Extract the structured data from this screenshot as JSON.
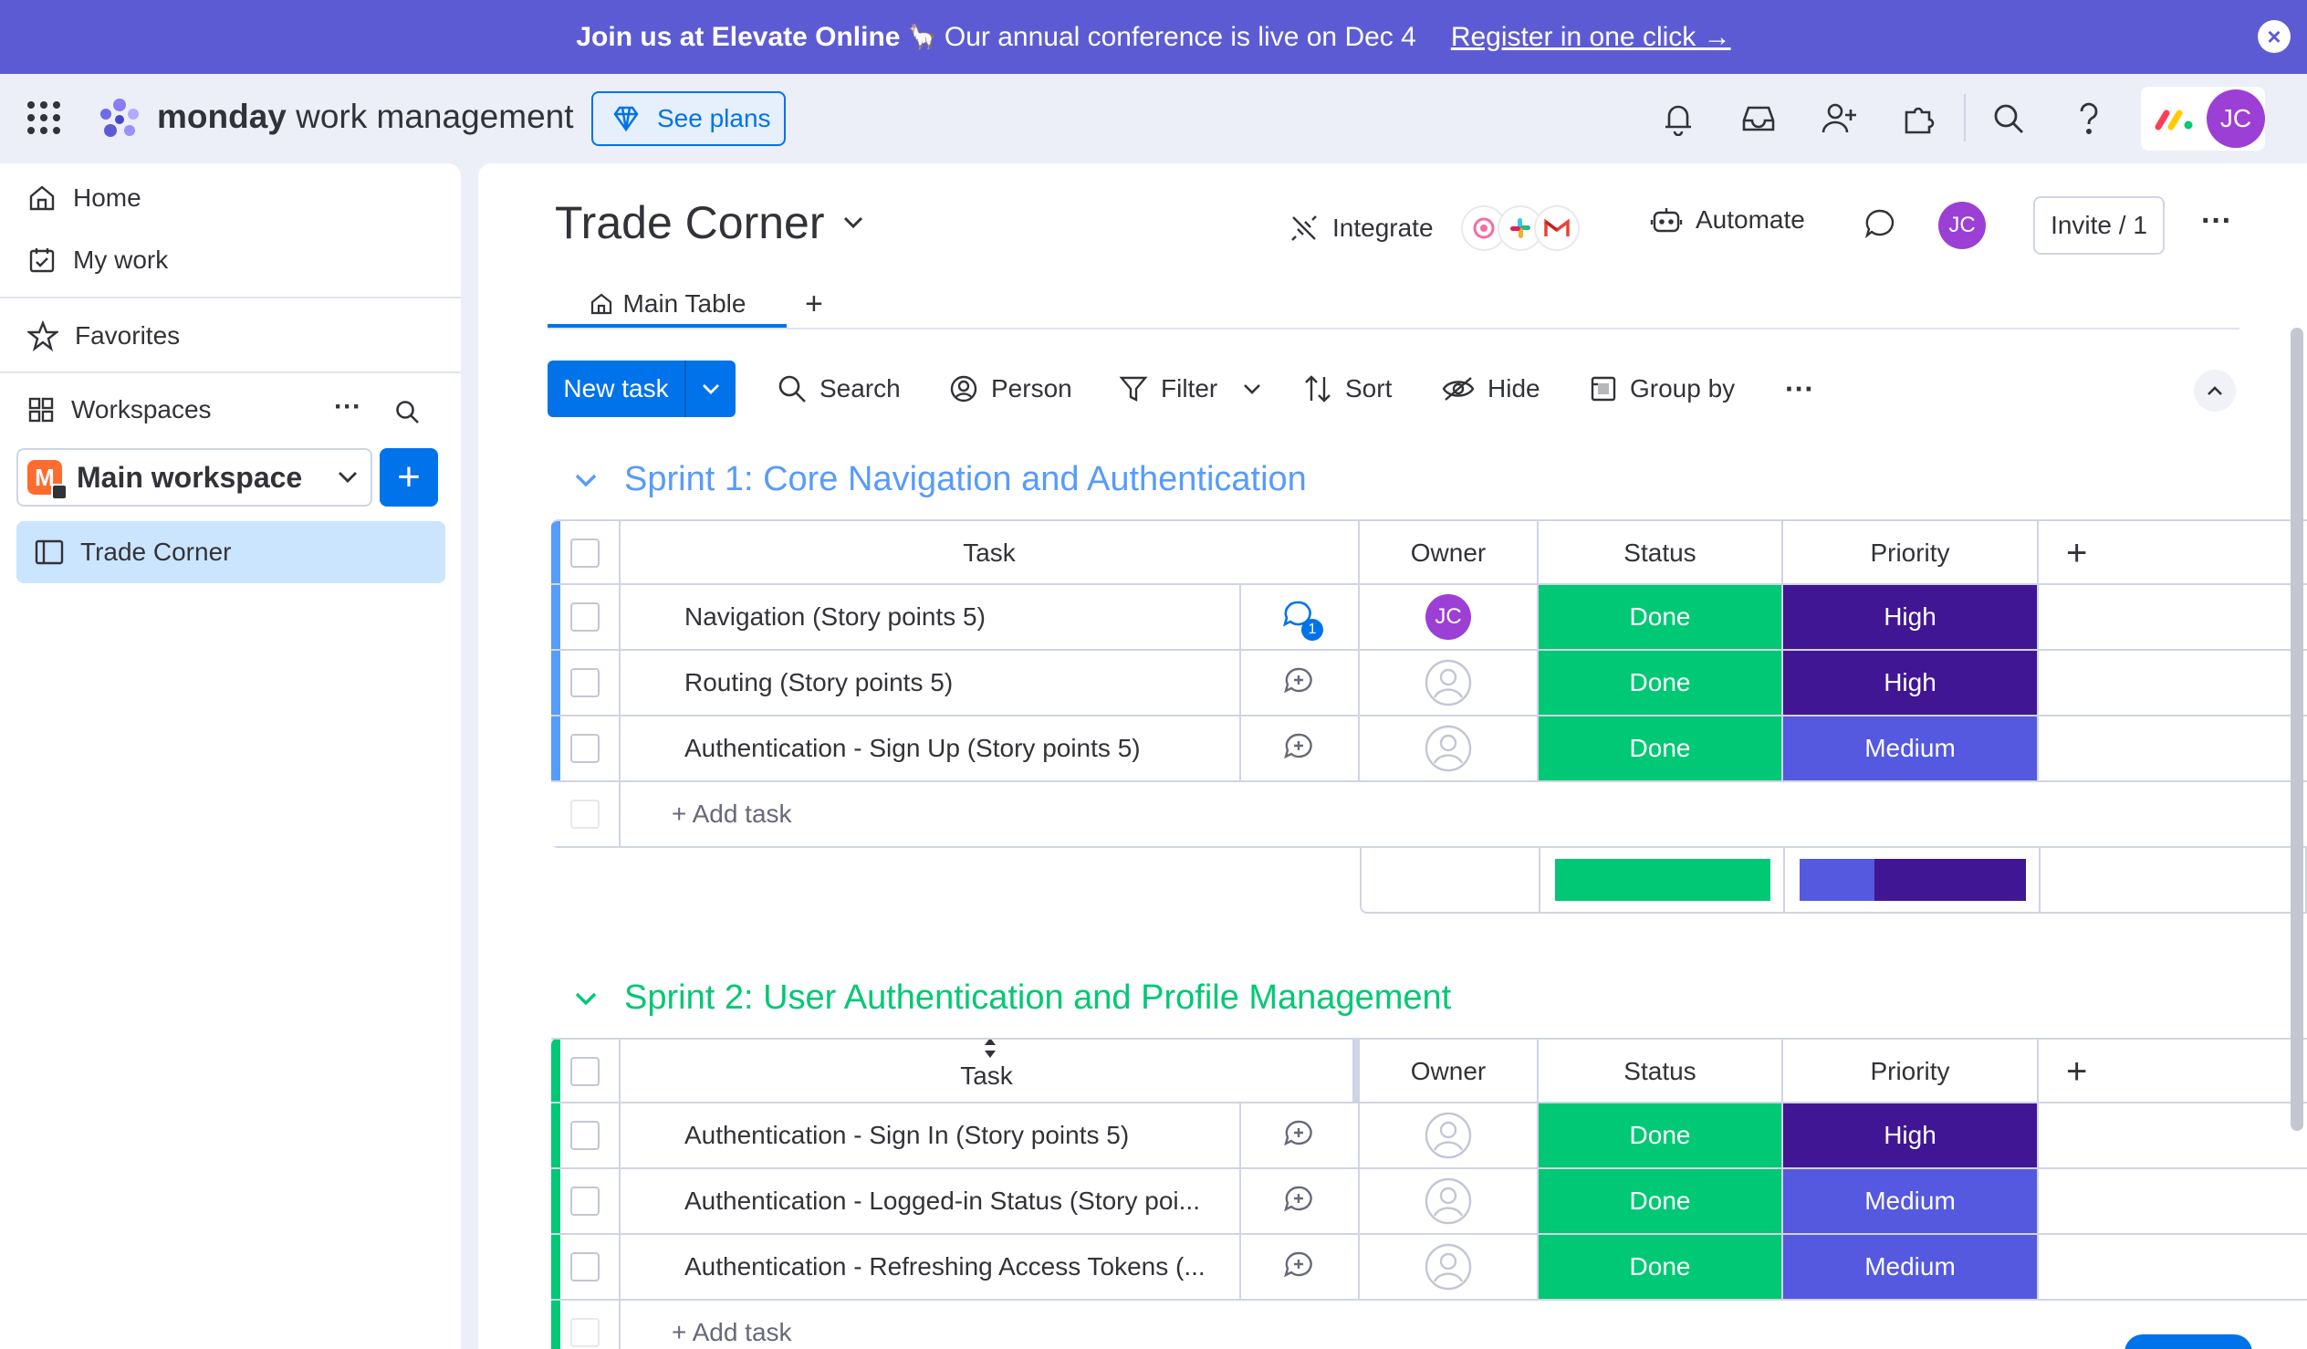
{
  "banner": {
    "strong": "Join us at Elevate Online",
    "llama": "🦙",
    "text": "Our annual conference is live on Dec 4",
    "link": "Register in one click →",
    "close": "×"
  },
  "topbar": {
    "brand_bold": "monday",
    "brand_rest": " work management",
    "see_plans": "See plans",
    "avatar": "JC"
  },
  "sidebar": {
    "home": "Home",
    "my_work": "My work",
    "favorites": "Favorites",
    "workspaces": "Workspaces",
    "workspaces_more": "···",
    "workspace_badge": "M",
    "workspace_name": "Main workspace",
    "add": "+",
    "board": "Trade Corner"
  },
  "board": {
    "title": "Trade Corner",
    "integrate": "Integrate",
    "automate": "Automate",
    "avatar": "JC",
    "invite": "Invite / 1",
    "more": "···",
    "tab_main": "Main Table",
    "tab_add": "+"
  },
  "toolbar": {
    "new_task": "New task",
    "search": "Search",
    "person": "Person",
    "filter": "Filter",
    "sort": "Sort",
    "hide": "Hide",
    "group_by": "Group by",
    "more": "···"
  },
  "columns": {
    "task": "Task",
    "owner": "Owner",
    "status": "Status",
    "priority": "Priority",
    "add": "+"
  },
  "colors": {
    "done": "#00c875",
    "high": "#401694",
    "medium": "#5559df",
    "group1": "#579bfc",
    "group2": "#00c875",
    "brand": "#0073ea"
  },
  "groups": [
    {
      "title": "Sprint 1: Core Navigation and Authentication",
      "add_task": "+ Add task",
      "rows": [
        {
          "task": "Navigation (Story points 5)",
          "owner": "JC",
          "updates": "1",
          "status": "Done",
          "priority": "High"
        },
        {
          "task": "Routing (Story points 5)",
          "owner": "",
          "updates": "",
          "status": "Done",
          "priority": "High"
        },
        {
          "task": "Authentication - Sign Up (Story points 5)",
          "owner": "",
          "updates": "",
          "status": "Done",
          "priority": "Medium"
        }
      ],
      "summary": {
        "status_done_fraction": 1.0,
        "priority_medium_fraction": 0.33,
        "priority_high_fraction": 0.67
      }
    },
    {
      "title": "Sprint 2: User Authentication and Profile Management",
      "add_task": "+ Add task",
      "rows": [
        {
          "task": "Authentication - Sign In (Story points 5)",
          "owner": "",
          "updates": "",
          "status": "Done",
          "priority": "High"
        },
        {
          "task": "Authentication - Logged-in Status (Story poi...",
          "owner": "",
          "updates": "",
          "status": "Done",
          "priority": "Medium"
        },
        {
          "task": "Authentication - Refreshing Access Tokens (...",
          "owner": "",
          "updates": "",
          "status": "Done",
          "priority": "Medium"
        }
      ]
    }
  ]
}
